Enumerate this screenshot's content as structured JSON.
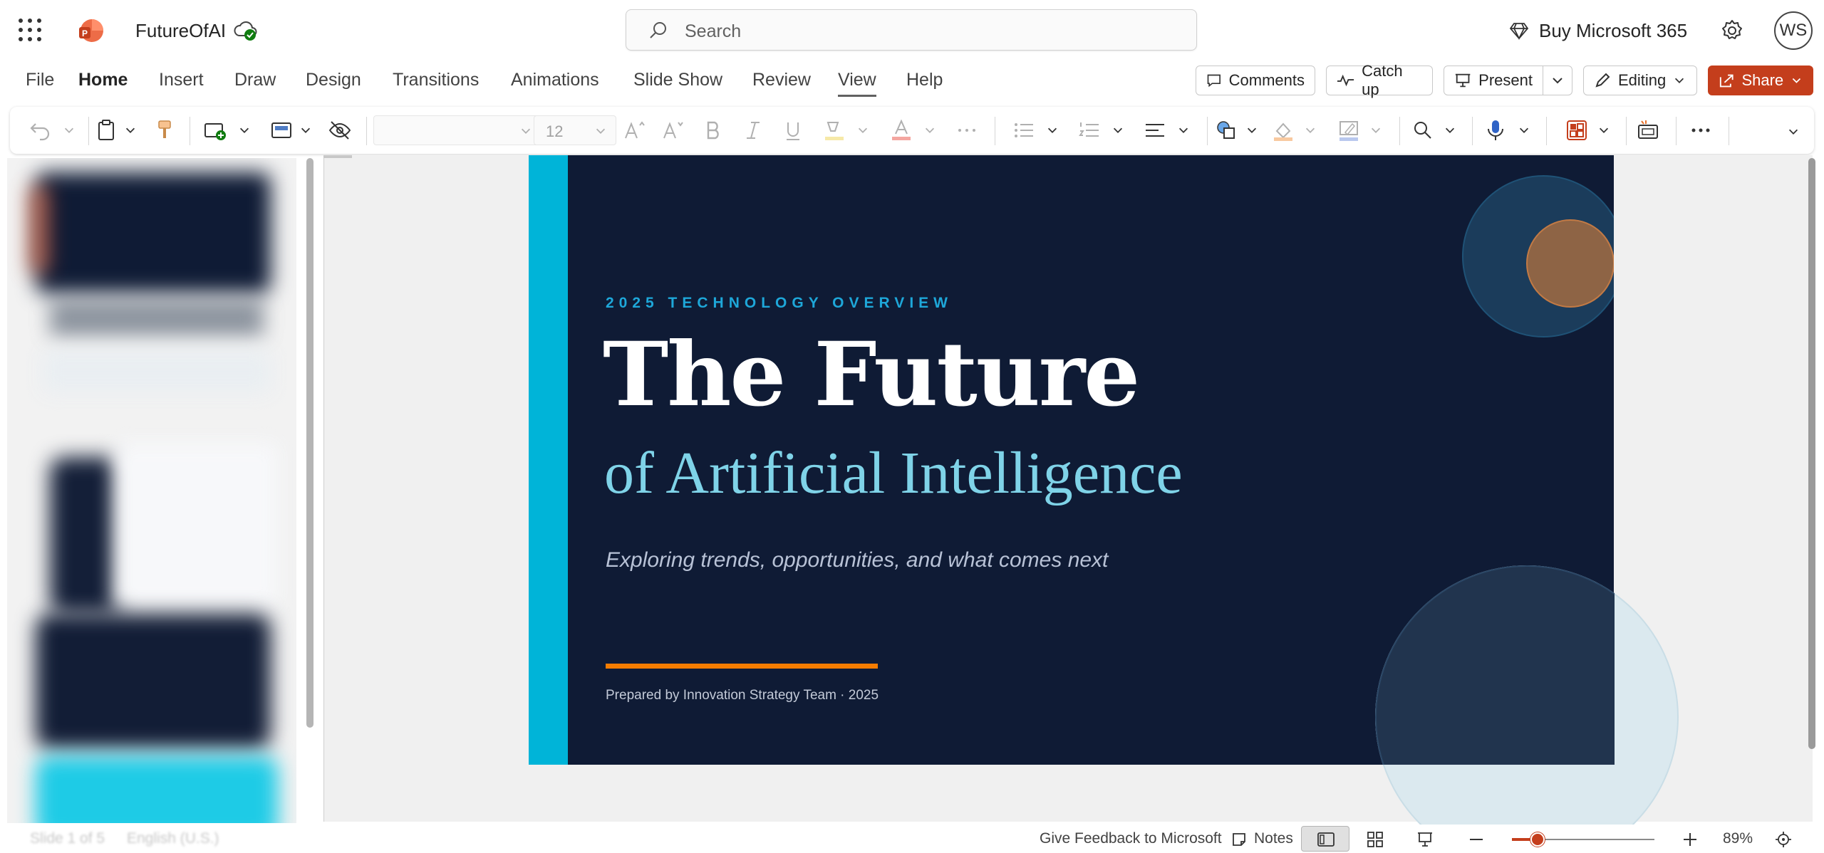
{
  "app": {
    "title": "FutureOfAI",
    "search_placeholder": "Search",
    "buy_label": "Buy Microsoft 365",
    "avatar_initials": "WS",
    "brand_color": "#c43e1c"
  },
  "menu": {
    "tabs": [
      "File",
      "Home",
      "Insert",
      "Draw",
      "Design",
      "Transitions",
      "Animations",
      "Slide Show",
      "Review",
      "View",
      "Help"
    ],
    "actions": {
      "comments": "Comments",
      "catch_up": "Catch up",
      "present": "Present",
      "editing": "Editing",
      "share": "Share"
    }
  },
  "ribbon": {
    "font_size": "12"
  },
  "slide": {
    "eyebrow": "2025 TECHNOLOGY OVERVIEW",
    "title_line1": "The Future",
    "title_line2": "of Artificial Intelligence",
    "tagline": "Exploring trends, opportunities, and what comes next",
    "byline": "Prepared by Innovation Strategy Team  ·  2025",
    "colors": {
      "background": "#0f1b35",
      "accent_bar": "#00b4d8",
      "title": "#ffffff",
      "subtitle": "#7fd3e8",
      "rule": "#f57c00"
    }
  },
  "status": {
    "slide_info": "Slide 1 of 5",
    "language": "English (U.S.)",
    "feedback": "Give Feedback to Microsoft",
    "notes": "Notes",
    "zoom": "89%",
    "zoom_fraction": 0.18
  }
}
